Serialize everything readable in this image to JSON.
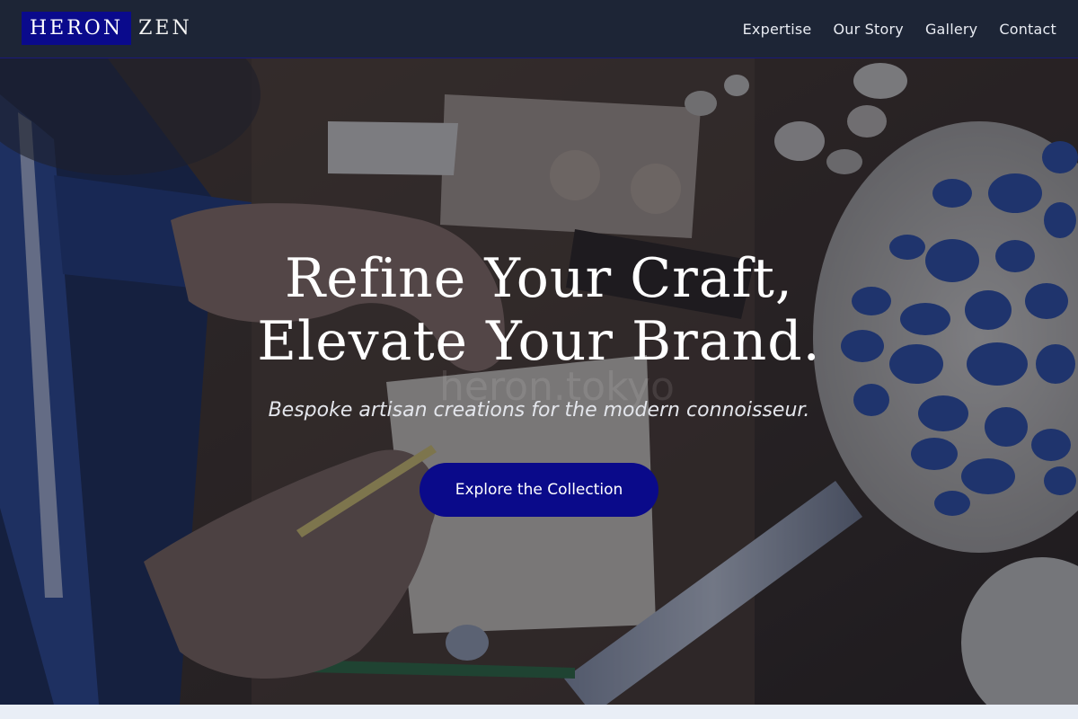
{
  "brand": {
    "logo_word1": "HERON",
    "logo_word2": "ZEN",
    "logo_accent": "#0a0a8c"
  },
  "nav": {
    "items": [
      "Expertise",
      "Our Story",
      "Gallery",
      "Contact"
    ]
  },
  "hero": {
    "title_line1": "Refine Your Craft,",
    "title_line2": "Elevate Your Brand.",
    "subtitle": "Bespoke artisan creations for the modern connoisseur.",
    "cta_label": "Explore the Collection",
    "watermark": "heron.tokyo",
    "background_icon": "craft-workbench-photo"
  },
  "colors": {
    "header_bg": "#1d2536",
    "cta_bg": "#0a0a8a",
    "text_light": "#ffffff"
  }
}
